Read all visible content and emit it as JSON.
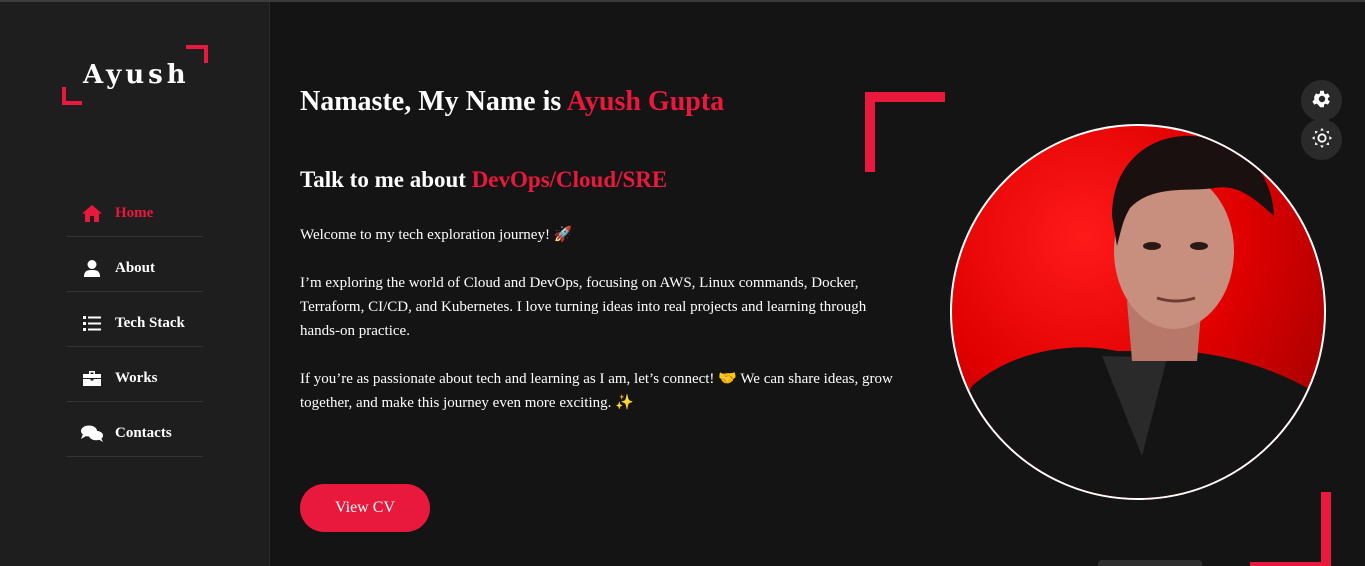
{
  "logo": {
    "text": "Ayush"
  },
  "nav": {
    "items": [
      {
        "label": "Home",
        "icon": "home-icon",
        "active": true
      },
      {
        "label": "About",
        "icon": "user-icon",
        "active": false
      },
      {
        "label": "Tech Stack",
        "icon": "list-icon",
        "active": false
      },
      {
        "label": "Works",
        "icon": "briefcase-icon",
        "active": false
      },
      {
        "label": "Contacts",
        "icon": "comments-icon",
        "active": false
      }
    ]
  },
  "hero": {
    "greeting_prefix": "Namaste, My Name is",
    "name": "Ayush Gupta",
    "talk_prefix": "Talk to me about",
    "topics": "DevOps/Cloud/SRE",
    "paragraph1": "Welcome to my tech exploration journey! 🚀",
    "paragraph2": "I’m exploring the world of Cloud and DevOps, focusing on AWS, Linux commands, Docker, Terraform, CI/CD, and Kubernetes. I love turning ideas into real projects and learning through hands-on practice.",
    "paragraph3": "If you’re as passionate about tech and learning as I am, let’s connect! 🤝 We can share ideas, grow together, and make this journey even more exciting. ✨",
    "cv_button": "View CV"
  },
  "colors": {
    "accent": "#e8193c",
    "background": "#141414",
    "sidebar": "#1e1e1e"
  },
  "settings": {
    "icons": [
      "gear-icon",
      "sun-icon"
    ]
  }
}
